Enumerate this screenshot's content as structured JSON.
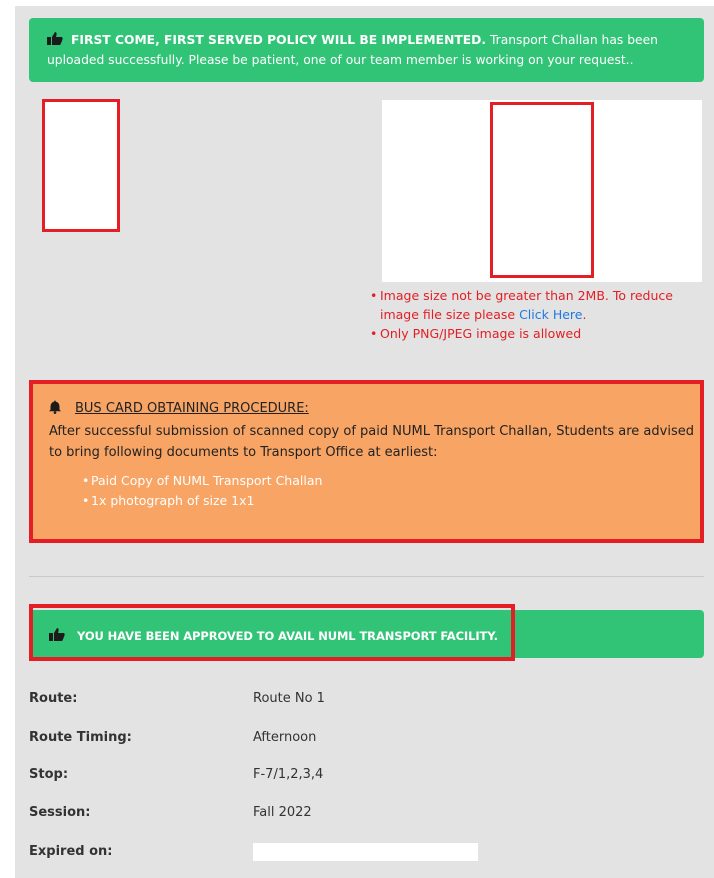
{
  "top_alert": {
    "bold_text": "FIRST COME, FIRST SERVED POLICY WILL BE IMPLEMENTED.",
    "text": "Transport Challan has been uploaded successfully. Please be patient, one of our team member is working on your request..",
    "icon": "thumbs-up-icon",
    "color": "#31c477"
  },
  "upload_notes": {
    "note1_prefix": "Image size not be greater than 2MB. To reduce image file size please",
    "note1_link": "Click Here",
    "note1_suffix": ".",
    "note2": "Only PNG/JPEG image is allowed"
  },
  "procedure": {
    "title": "BUS CARD OBTAINING PROCEDURE:",
    "text": "After successful submission of scanned copy of paid NUML Transport Challan, Students are advised to bring following documents to Transport Office at earliest:",
    "items": [
      "Paid Copy of NUML Transport Challan",
      "1x photograph of size 1x1"
    ],
    "icon": "bell-icon",
    "color": "#f7a464"
  },
  "approved_alert": {
    "text": "YOU HAVE BEEN APPROVED TO AVAIL NUML TRANSPORT FACILITY.",
    "icon": "thumbs-up-icon"
  },
  "details": {
    "route_label": "Route:",
    "route_value": "Route No 1",
    "timing_label": "Route Timing:",
    "timing_value": "Afternoon",
    "stop_label": "Stop:",
    "stop_value": "F-7/1,2,3,4",
    "session_label": "Session:",
    "session_value": "Fall 2022",
    "expired_label": "Expired on:",
    "expired_value": ""
  },
  "colors": {
    "highlight": "#e31e24",
    "link": "#1f7ae0"
  }
}
